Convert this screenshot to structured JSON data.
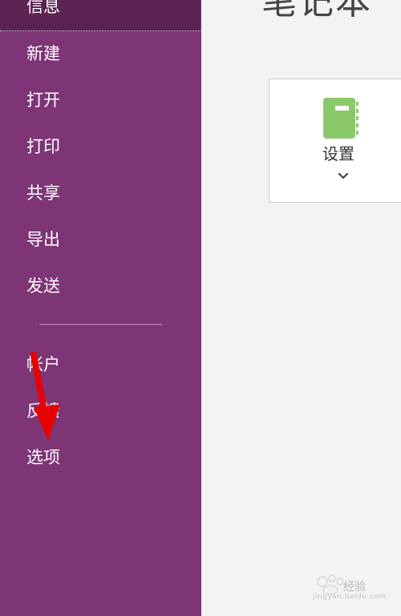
{
  "sidebar": {
    "active_item": "信息",
    "items": [
      "新建",
      "打开",
      "打印",
      "共享",
      "导出",
      "发送"
    ],
    "footer_items": [
      "帐户",
      "反馈",
      "选项"
    ]
  },
  "main": {
    "title": "笔记本",
    "settings_card": {
      "label": "设置",
      "icon": "notebook-icon"
    }
  },
  "watermark": {
    "text": "经验",
    "url_text": "jingyan.baidu.com"
  },
  "colors": {
    "sidebar": "#7d3575",
    "sidebar_active": "#5b2453",
    "content_background": "#f3f3f3",
    "notebook_icon": "#8bc86a",
    "arrow": "#e80000"
  }
}
